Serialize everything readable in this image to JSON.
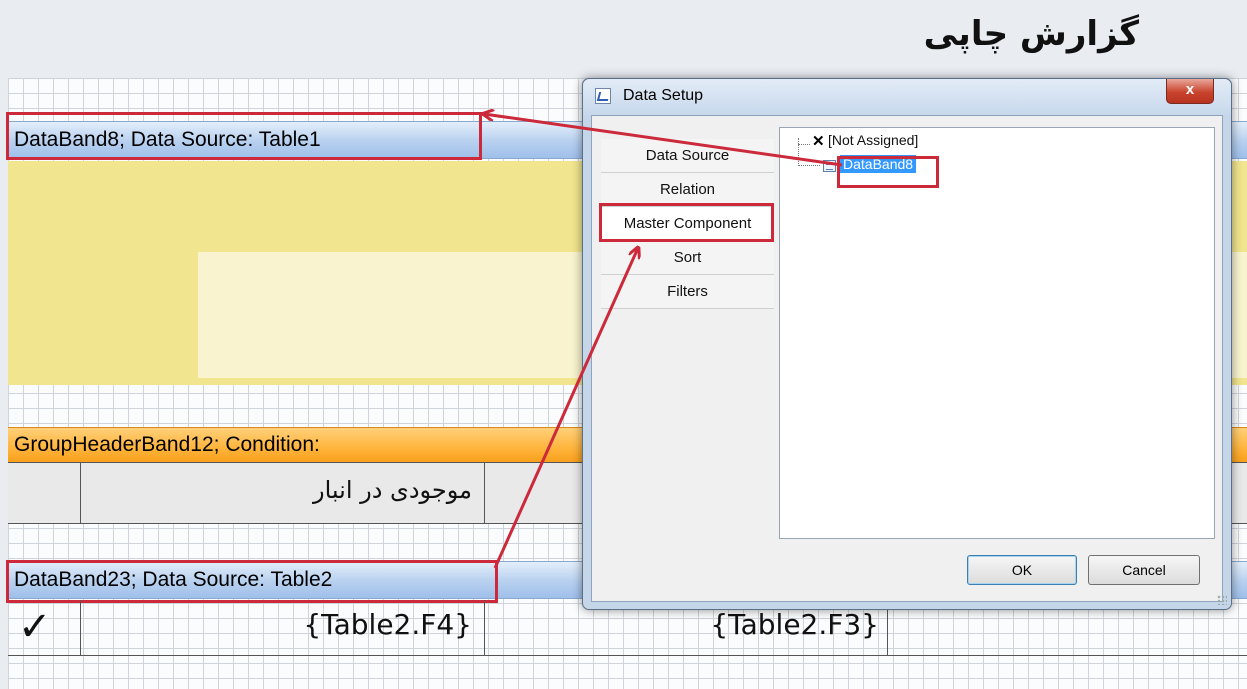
{
  "page_title": "گزارش چاپی",
  "bands": {
    "databand8_label": "DataBand8; Data Source: Table1",
    "group_header_label": "GroupHeaderBand12; Condition:",
    "databand23_label": "DataBand23; Data Source: Table2"
  },
  "header_row": {
    "col_inventory": "موجودی در انبار"
  },
  "data_row": {
    "check_mark": "✓",
    "f4": "{Table2.F4}",
    "f3": "{Table2.F3}"
  },
  "dialog": {
    "title": "Data Setup",
    "close_glyph": "x",
    "tabs": [
      "Data Source",
      "Relation",
      "Master Component",
      "Sort",
      "Filters"
    ],
    "tree": {
      "not_assigned": "[Not Assigned]",
      "not_assigned_mark": "✕",
      "databand8": "DataBand8"
    },
    "ok_label": "OK",
    "cancel_label": "Cancel"
  },
  "colors": {
    "highlight": "#cc2a3a",
    "band_blue": "#b7d0ef",
    "band_orange": "#ffb43b",
    "selection": "#3399ff"
  }
}
